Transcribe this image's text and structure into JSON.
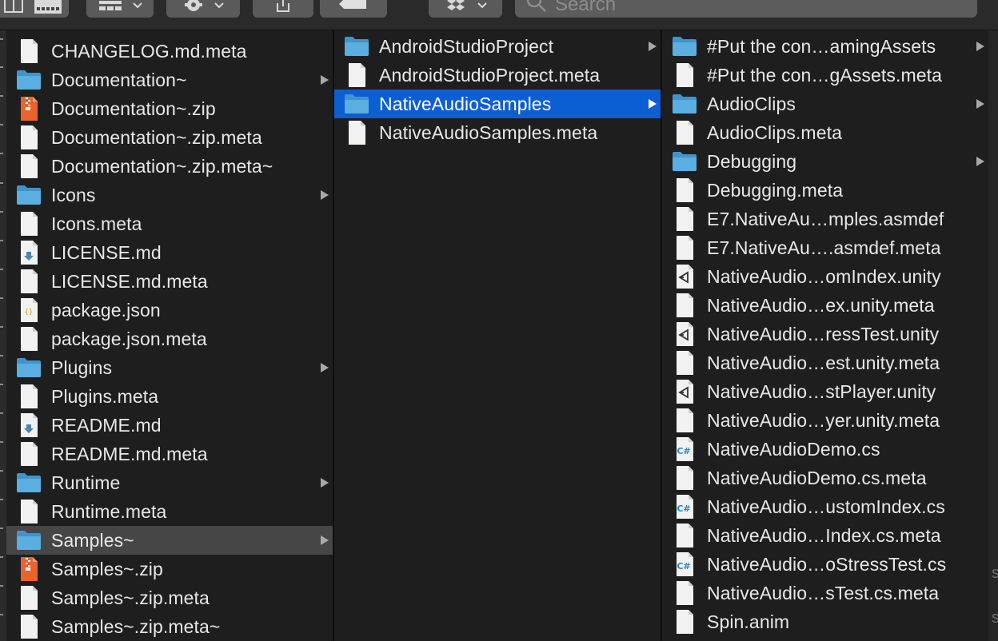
{
  "toolbar": {
    "search_placeholder": "Search",
    "buttons": [
      "view-mode-icon",
      "group-by-icon",
      "action-gear-icon",
      "share-icon",
      "tag-icon",
      "dropbox-icon"
    ]
  },
  "colors": {
    "folder": "#5aaee0",
    "selection_active": "#0c5fd3",
    "selection_inactive": "#464646",
    "zip": "#e8642c"
  },
  "columns": [
    {
      "items": [
        {
          "label": "CHANGELOG.md.meta",
          "icon": "document-icon",
          "folder": false
        },
        {
          "label": "Documentation~",
          "icon": "folder-icon",
          "folder": true
        },
        {
          "label": "Documentation~.zip",
          "icon": "zip-icon",
          "folder": false
        },
        {
          "label": "Documentation~.zip.meta",
          "icon": "document-icon",
          "folder": false
        },
        {
          "label": "Documentation~.zip.meta~",
          "icon": "document-icon",
          "folder": false
        },
        {
          "label": "Icons",
          "icon": "folder-icon",
          "folder": true
        },
        {
          "label": "Icons.meta",
          "icon": "document-icon",
          "folder": false
        },
        {
          "label": "LICENSE.md",
          "icon": "markdown-icon",
          "folder": false
        },
        {
          "label": "LICENSE.md.meta",
          "icon": "document-icon",
          "folder": false
        },
        {
          "label": "package.json",
          "icon": "json-icon",
          "folder": false
        },
        {
          "label": "package.json.meta",
          "icon": "document-icon",
          "folder": false
        },
        {
          "label": "Plugins",
          "icon": "folder-icon",
          "folder": true
        },
        {
          "label": "Plugins.meta",
          "icon": "document-icon",
          "folder": false
        },
        {
          "label": "README.md",
          "icon": "markdown-icon",
          "folder": false
        },
        {
          "label": "README.md.meta",
          "icon": "document-icon",
          "folder": false
        },
        {
          "label": "Runtime",
          "icon": "folder-icon",
          "folder": true
        },
        {
          "label": "Runtime.meta",
          "icon": "document-icon",
          "folder": false
        },
        {
          "label": "Samples~",
          "icon": "folder-icon",
          "folder": true,
          "selected": "inactive"
        },
        {
          "label": "Samples~.zip",
          "icon": "zip-icon",
          "folder": false
        },
        {
          "label": "Samples~.zip.meta",
          "icon": "document-icon",
          "folder": false
        },
        {
          "label": "Samples~.zip.meta~",
          "icon": "document-icon",
          "folder": false
        }
      ]
    },
    {
      "items": [
        {
          "label": "AndroidStudioProject",
          "icon": "folder-icon",
          "folder": true
        },
        {
          "label": "AndroidStudioProject.meta",
          "icon": "document-icon",
          "folder": false
        },
        {
          "label": "NativeAudioSamples",
          "icon": "folder-icon",
          "folder": true,
          "selected": "active"
        },
        {
          "label": "NativeAudioSamples.meta",
          "icon": "document-icon",
          "folder": false
        }
      ]
    },
    {
      "items": [
        {
          "label": "#Put the con…amingAssets",
          "icon": "folder-icon",
          "folder": true
        },
        {
          "label": "#Put the con…gAssets.meta",
          "icon": "document-icon",
          "folder": false
        },
        {
          "label": "AudioClips",
          "icon": "folder-icon",
          "folder": true
        },
        {
          "label": "AudioClips.meta",
          "icon": "document-icon",
          "folder": false
        },
        {
          "label": "Debugging",
          "icon": "folder-icon",
          "folder": true
        },
        {
          "label": "Debugging.meta",
          "icon": "document-icon",
          "folder": false
        },
        {
          "label": "E7.NativeAu…mples.asmdef",
          "icon": "document-icon",
          "folder": false
        },
        {
          "label": "E7.NativeAu….asmdef.meta",
          "icon": "document-icon",
          "folder": false
        },
        {
          "label": "NativeAudio…omIndex.unity",
          "icon": "unity-icon",
          "folder": false
        },
        {
          "label": "NativeAudio…ex.unity.meta",
          "icon": "document-icon",
          "folder": false
        },
        {
          "label": "NativeAudio…ressTest.unity",
          "icon": "unity-icon",
          "folder": false
        },
        {
          "label": "NativeAudio…est.unity.meta",
          "icon": "document-icon",
          "folder": false
        },
        {
          "label": "NativeAudio…stPlayer.unity",
          "icon": "unity-icon",
          "folder": false
        },
        {
          "label": "NativeAudio…yer.unity.meta",
          "icon": "document-icon",
          "folder": false
        },
        {
          "label": "NativeAudioDemo.cs",
          "icon": "csharp-icon",
          "folder": false
        },
        {
          "label": "NativeAudioDemo.cs.meta",
          "icon": "document-icon",
          "folder": false
        },
        {
          "label": "NativeAudio…ustomIndex.cs",
          "icon": "csharp-icon",
          "folder": false
        },
        {
          "label": "NativeAudio…Index.cs.meta",
          "icon": "document-icon",
          "folder": false
        },
        {
          "label": "NativeAudio…oStressTest.cs",
          "icon": "csharp-icon",
          "folder": false
        },
        {
          "label": "NativeAudio…sTest.cs.meta",
          "icon": "document-icon",
          "folder": false
        },
        {
          "label": "Spin.anim",
          "icon": "document-icon",
          "folder": false
        }
      ]
    }
  ]
}
